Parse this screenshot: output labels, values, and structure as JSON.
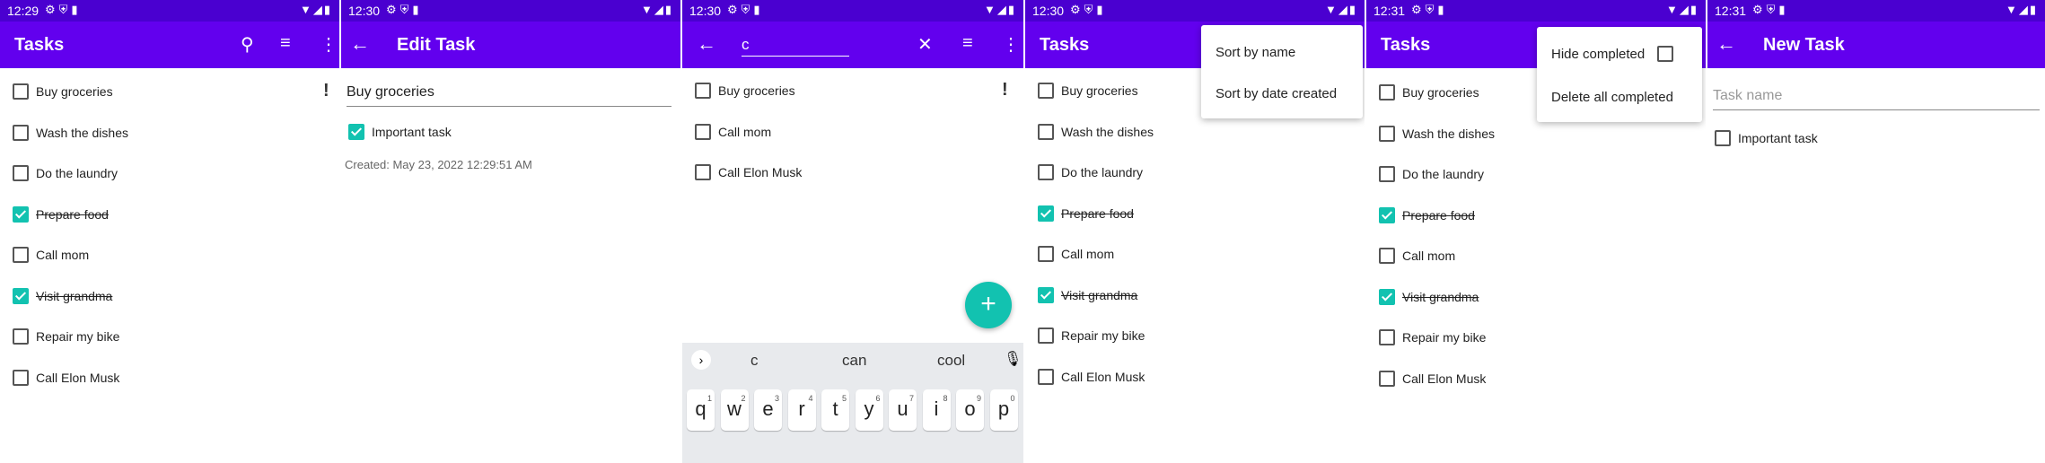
{
  "status": {
    "p1": "12:29",
    "p2": "12:30",
    "p3": "12:30",
    "p4": "12:30",
    "p5": "12:31",
    "p6": "12:31"
  },
  "tasks_title": "Tasks",
  "edit": {
    "title": "Edit Task",
    "task_name": "Buy groceries",
    "important_label": "Important task",
    "created": "Created: May 23, 2022 12:29:51 AM"
  },
  "search": {
    "query": "c"
  },
  "tasks": [
    {
      "name": "Buy groceries",
      "done": false,
      "important": true
    },
    {
      "name": "Wash the dishes",
      "done": false
    },
    {
      "name": "Do the laundry",
      "done": false
    },
    {
      "name": "Prepare food",
      "done": true
    },
    {
      "name": "Call mom",
      "done": false
    },
    {
      "name": "Visit grandma",
      "done": true
    },
    {
      "name": "Repair my bike",
      "done": false
    },
    {
      "name": "Call Elon Musk",
      "done": false
    }
  ],
  "search_results": [
    "Buy groceries",
    "Call mom",
    "Call Elon Musk"
  ],
  "sort_menu": {
    "by_name": "Sort by name",
    "by_date": "Sort by date created"
  },
  "overflow_menu": {
    "hide_completed": "Hide completed",
    "delete_completed": "Delete all completed"
  },
  "new_task": {
    "title": "New Task",
    "placeholder": "Task name",
    "important_label": "Important task"
  },
  "keyboard": {
    "suggestions": [
      "c",
      "can",
      "cool"
    ],
    "keys": [
      "q",
      "w",
      "e",
      "r",
      "t",
      "y",
      "u",
      "i",
      "o",
      "p"
    ],
    "numbers": [
      "1",
      "2",
      "3",
      "4",
      "5",
      "6",
      "7",
      "8",
      "9",
      "0"
    ]
  },
  "icons": {
    "fab": "+",
    "exclamation": "!"
  },
  "colors": {
    "statusbar": "#4a00d0",
    "appbar": "#6200ee",
    "accent": "#12c2b0"
  }
}
